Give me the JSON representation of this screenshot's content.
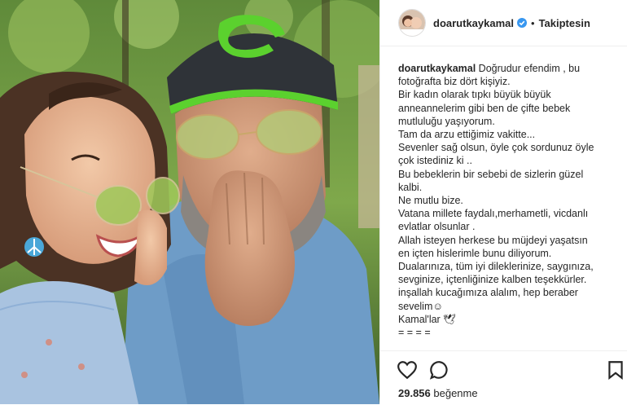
{
  "header": {
    "username": "doarutkaykamal",
    "follow_label": "Takiptesin",
    "separator": "•"
  },
  "caption": {
    "username": "doarutkaykamal",
    "first_line": "Doğrudur efendim , bu",
    "lines": [
      "fotoğrafta biz dört kişiyiz.",
      "Bir kadın olarak tıpkı büyük büyük",
      "anneannelerim gibi ben de çifte bebek",
      "mutluluğu yaşıyorum.",
      "Tam da arzu ettiğimiz vakitte...",
      "Sevenler sağ olsun, öyle çok sordunuz öyle",
      "çok istediniz ki ..",
      "Bu bebeklerin bir sebebi de sizlerin güzel",
      "kalbi.",
      "Ne mutlu bize.",
      "Vatana millete faydalı,merhametli, vicdanlı",
      "evlatlar olsunlar .",
      "Allah isteyen herkese bu müjdeyi yaşatsın",
      "en içten hislerimle bunu diliyorum.",
      "Dualarınıza, tüm iyi dileklerinize, saygınıza,",
      "sevginize, içtenliğinize kalben teşekkürler.",
      "inşallah kucağımıza alalım, hep beraber",
      "sevelim☺",
      "Kamal'lar 🕊",
      "= = = ="
    ]
  },
  "actions": {
    "likes_count": "29.856",
    "likes_label": "beğenme"
  },
  "colors": {
    "verified": "#3897f0",
    "text": "#262626",
    "border": "#efefef"
  }
}
